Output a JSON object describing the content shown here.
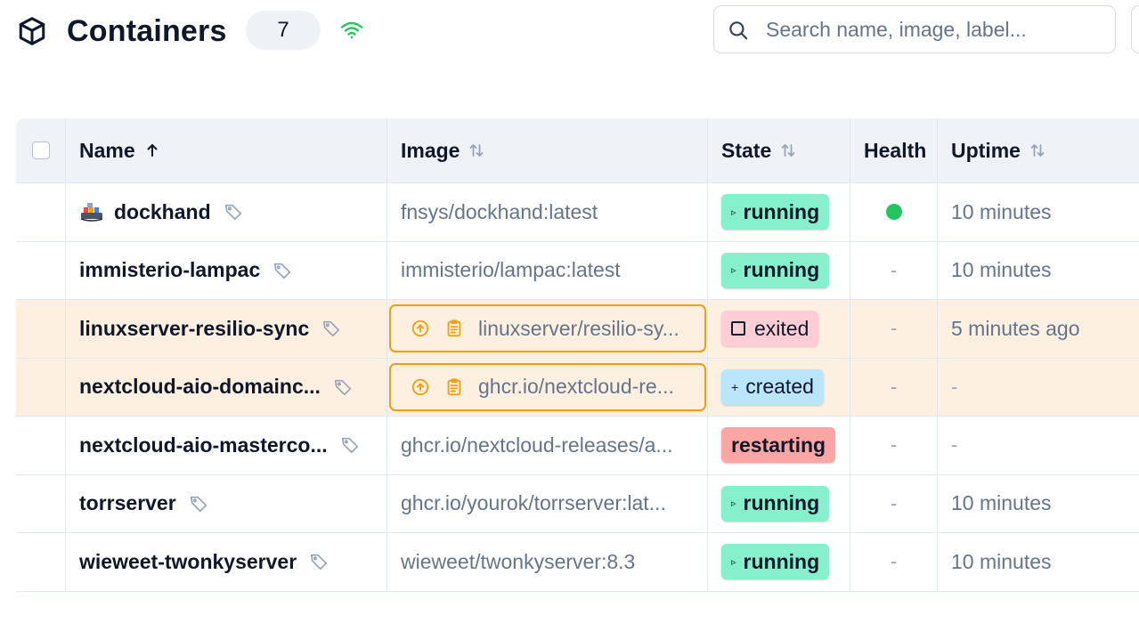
{
  "header": {
    "title": "Containers",
    "count": "7"
  },
  "search": {
    "placeholder": "Search name, image, label..."
  },
  "columns": {
    "name": "Name",
    "image": "Image",
    "state": "State",
    "health": "Health",
    "uptime": "Uptime"
  },
  "rows": [
    {
      "name": "dockhand",
      "image": "fnsys/dockhand:latest",
      "state": "running",
      "health": "",
      "uptime": "10 minutes"
    },
    {
      "name": "immisterio-lampac",
      "image": "immisterio/lampac:latest",
      "state": "running",
      "health": "-",
      "uptime": "10 minutes"
    },
    {
      "name": "linuxserver-resilio-sync",
      "image": "linuxserver/resilio-sy...",
      "state": "exited",
      "health": "-",
      "uptime": "5 minutes ago"
    },
    {
      "name": "nextcloud-aio-domainc...",
      "image": "ghcr.io/nextcloud-re...",
      "state": "created",
      "health": "-",
      "uptime": "-"
    },
    {
      "name": "nextcloud-aio-masterco...",
      "image": "ghcr.io/nextcloud-releases/a...",
      "state": "restarting",
      "health": "-",
      "uptime": "-"
    },
    {
      "name": "torrserver",
      "image": "ghcr.io/yourok/torrserver:lat...",
      "state": "running",
      "health": "-",
      "uptime": "10 minutes"
    },
    {
      "name": "wieweet-twonkyserver",
      "image": "wieweet/twonkyserver:8.3",
      "state": "running",
      "health": "-",
      "uptime": "10 minutes"
    }
  ],
  "colors": {
    "running": "#86efcb",
    "exited": "#fecdd6",
    "created": "#bae6fd",
    "restarting": "#fca5a5",
    "update_highlight": "#f59e0b",
    "health_ok": "#22c55e"
  }
}
